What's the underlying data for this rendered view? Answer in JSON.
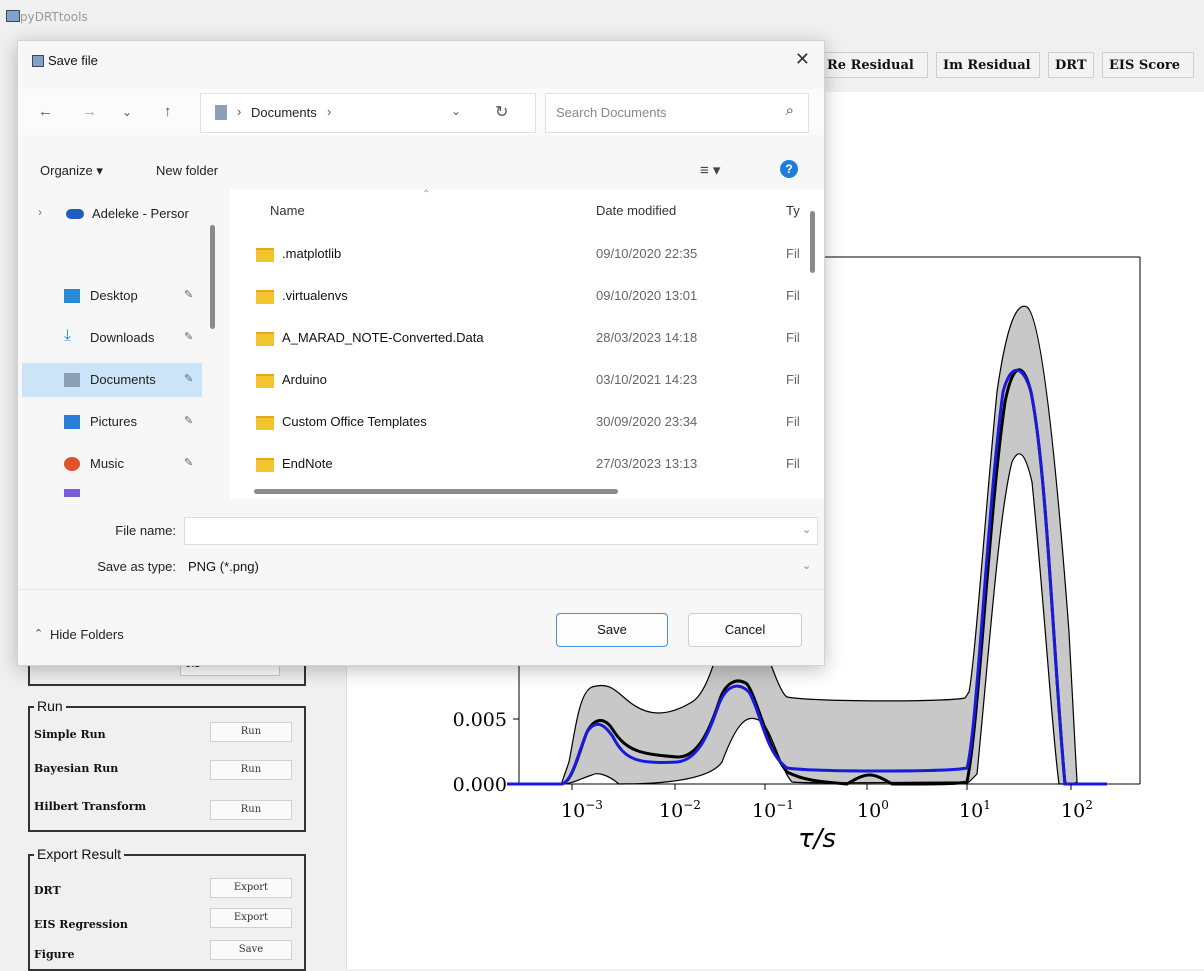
{
  "app": {
    "title": "pyDRTtools"
  },
  "tabs": {
    "re_residual": "Re Residual",
    "im_residual": "Im Residual",
    "drt": "DRT",
    "eis_score": "EIS Score"
  },
  "plot": {
    "y_ticks": [
      "0.005",
      "0.000"
    ],
    "x_ticks": [
      {
        "base": "10",
        "exp": "−3"
      },
      {
        "base": "10",
        "exp": "−2"
      },
      {
        "base": "10",
        "exp": "−1"
      },
      {
        "base": "10",
        "exp": "0"
      },
      {
        "base": "10",
        "exp": "1"
      },
      {
        "base": "10",
        "exp": "2"
      }
    ],
    "x_label": "τ/s",
    "colors": {
      "mean": "#000000",
      "map": "#1a1adc",
      "band": "#c8c8c8"
    }
  },
  "left_panel": {
    "hidden_field_value": "0.5",
    "run_group": {
      "title": "Run",
      "rows": [
        {
          "label": "Simple Run",
          "button": "Run"
        },
        {
          "label": "Bayesian Run",
          "button": "Run"
        },
        {
          "label": "Hilbert Transform",
          "button": "Run"
        }
      ]
    },
    "export_group": {
      "title": "Export Result",
      "rows": [
        {
          "label": "DRT",
          "button": "Export"
        },
        {
          "label": "EIS Regression",
          "button": "Export"
        },
        {
          "label": "Figure",
          "button": "Save"
        }
      ]
    }
  },
  "dialog": {
    "title": "Save file",
    "address": {
      "location": "Documents",
      "sep1": "›",
      "sep2": "›"
    },
    "search_placeholder": "Search Documents",
    "toolbar": {
      "organize": "Organize ▾",
      "new_folder": "New folder"
    },
    "sidebar": {
      "onedrive": "Adeleke - Persor",
      "items": [
        {
          "label": "Desktop",
          "icon": "desktop-icon",
          "color": "#2b8ad8"
        },
        {
          "label": "Downloads",
          "icon": "download-icon",
          "color": "#2b8ad8"
        },
        {
          "label": "Documents",
          "icon": "document-icon",
          "color": "#8ca0b8"
        },
        {
          "label": "Pictures",
          "icon": "pictures-icon",
          "color": "#2b7fd8"
        },
        {
          "label": "Music",
          "icon": "music-icon",
          "color": "#e0522a"
        }
      ]
    },
    "columns": {
      "name": "Name",
      "date": "Date modified",
      "type": "Ty"
    },
    "files": [
      {
        "name": ".matplotlib",
        "date": "09/10/2020 22:35",
        "type": "Fil"
      },
      {
        "name": ".virtualenvs",
        "date": "09/10/2020 13:01",
        "type": "Fil"
      },
      {
        "name": "A_MARAD_NOTE-Converted.Data",
        "date": "28/03/2023 14:18",
        "type": "Fil"
      },
      {
        "name": "Arduino",
        "date": "03/10/2021 14:23",
        "type": "Fil"
      },
      {
        "name": "Custom Office Templates",
        "date": "30/09/2020 23:34",
        "type": "Fil"
      },
      {
        "name": "EndNote",
        "date": "27/03/2023 13:13",
        "type": "Fil"
      }
    ],
    "file_name_label": "File name:",
    "file_name_value": "",
    "save_type_label": "Save as type:",
    "save_type_value": "PNG (*.png)",
    "hide_folders": "Hide Folders",
    "save_button": "Save",
    "cancel_button": "Cancel"
  }
}
